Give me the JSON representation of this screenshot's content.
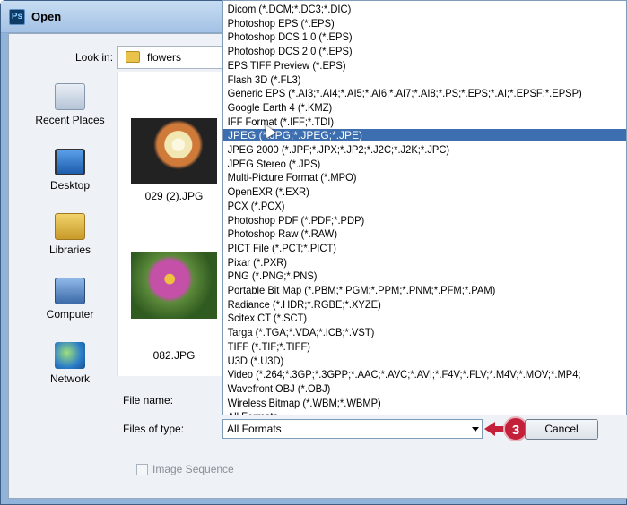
{
  "window": {
    "title": "Open",
    "app_icon": "Ps"
  },
  "look_in": {
    "label": "Look in:",
    "value": "flowers"
  },
  "places": [
    {
      "label": "Recent Places",
      "icon": "recent-places-icon"
    },
    {
      "label": "Desktop",
      "icon": "desktop-icon"
    },
    {
      "label": "Libraries",
      "icon": "libraries-icon"
    },
    {
      "label": "Computer",
      "icon": "computer-icon"
    },
    {
      "label": "Network",
      "icon": "network-icon"
    }
  ],
  "files": [
    {
      "name": "029 (2).JPG"
    },
    {
      "name": "082.JPG"
    }
  ],
  "file_name_label": "File name:",
  "files_of_type": {
    "label": "Files of type:",
    "value": "All Formats"
  },
  "cancel_label": "Cancel",
  "callout": "3",
  "image_sequence_label": "Image Sequence",
  "formats": [
    "Dicom (*.DCM;*.DC3;*.DIC)",
    "Photoshop EPS (*.EPS)",
    "Photoshop DCS 1.0 (*.EPS)",
    "Photoshop DCS 2.0 (*.EPS)",
    "EPS TIFF Preview (*.EPS)",
    "Flash 3D (*.FL3)",
    "Generic EPS (*.AI3;*.AI4;*.AI5;*.AI6;*.AI7;*.AI8;*.PS;*.EPS;*.AI;*.EPSF;*.EPSP)",
    "Google Earth 4 (*.KMZ)",
    "IFF Format (*.IFF;*.TDI)",
    "JPEG (*.JPG;*.JPEG;*.JPE)",
    "JPEG 2000 (*.JPF;*.JPX;*.JP2;*.J2C;*.J2K;*.JPC)",
    "JPEG Stereo (*.JPS)",
    "Multi-Picture Format (*.MPO)",
    "OpenEXR (*.EXR)",
    "PCX (*.PCX)",
    "Photoshop PDF (*.PDF;*.PDP)",
    "Photoshop Raw (*.RAW)",
    "PICT File (*.PCT;*.PICT)",
    "Pixar (*.PXR)",
    "PNG (*.PNG;*.PNS)",
    "Portable Bit Map (*.PBM;*.PGM;*.PPM;*.PNM;*.PFM;*.PAM)",
    "Radiance (*.HDR;*.RGBE;*.XYZE)",
    "Scitex CT (*.SCT)",
    "Targa (*.TGA;*.VDA;*.ICB;*.VST)",
    "TIFF (*.TIF;*.TIFF)",
    "U3D (*.U3D)",
    "Video (*.264;*.3GP;*.3GPP;*.AAC;*.AVC;*.AVI;*.F4V;*.FLV;*.M4V;*.MOV;*.MP4;",
    "Wavefront|OBJ (*.OBJ)",
    "Wireless Bitmap (*.WBM;*.WBMP)",
    "All Formats"
  ],
  "selected_format": "JPEG (*.JPG;*.JPEG;*.JPE)"
}
